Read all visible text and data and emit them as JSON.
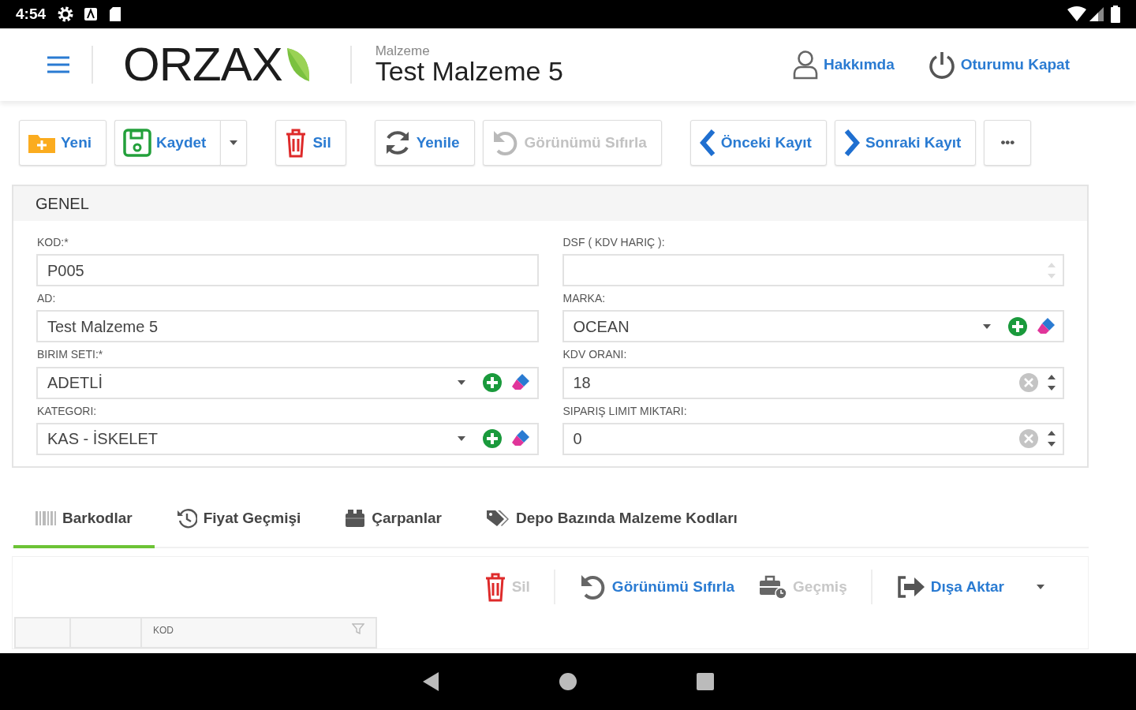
{
  "status_bar": {
    "time": "4:54"
  },
  "header": {
    "logo": "ORZAX",
    "page_kind": "Malzeme",
    "title": "Test Malzeme 5",
    "links": [
      {
        "label": "Hakkımda"
      },
      {
        "label": "Oturumu Kapat"
      }
    ]
  },
  "toolbar": {
    "groups": [
      [
        {
          "label": "Yeni",
          "kind": "button",
          "disabled": false
        },
        {
          "label": "Kaydet",
          "kind": "split",
          "disabled": false
        }
      ],
      [
        {
          "label": "Sil",
          "kind": "button",
          "disabled": false
        }
      ],
      [
        {
          "label": "Yenile",
          "kind": "button",
          "disabled": false
        },
        {
          "label": "Görünümü Sıfırla",
          "kind": "button",
          "disabled": true
        }
      ],
      [
        {
          "label": "Önceki Kayıt",
          "kind": "button",
          "disabled": false
        },
        {
          "label": "Sonraki Kayıt",
          "kind": "button",
          "disabled": false
        },
        {
          "label": "•••",
          "kind": "more",
          "disabled": false
        }
      ]
    ]
  },
  "panel": {
    "title": "GENEL",
    "columns": [
      [
        {
          "label": "KOD:*",
          "kind": "text",
          "value": "P005"
        },
        {
          "label": "AD:",
          "kind": "text",
          "value": "Test Malzeme 5"
        },
        {
          "label": "BIRIM SETI:*",
          "kind": "select",
          "value": "ADETLİ"
        },
        {
          "label": "KATEGORI:",
          "kind": "select",
          "value": "KAS - İSKELET"
        }
      ],
      [
        {
          "label": "DSF ( KDV HARIÇ ):",
          "kind": "number"
        },
        {
          "label": "MARKA:",
          "kind": "select",
          "value": "OCEAN"
        },
        {
          "label": "KDV ORANI:",
          "kind": "number",
          "value": "18"
        },
        {
          "label": "SIPARIŞ LIMIT MIKTARI:",
          "kind": "number",
          "value": "0"
        }
      ]
    ]
  },
  "tabs": [
    {
      "label": "Barkodlar",
      "selected": true
    },
    {
      "label": "Fiyat Geçmişi",
      "selected": false
    },
    {
      "label": "Çarpanlar",
      "selected": false
    },
    {
      "label": "Depo Bazında Malzeme Kodları",
      "selected": false
    }
  ],
  "grid_toolbar": {
    "groups": [
      [
        {
          "label": "Sil",
          "kind": "button",
          "disabled": true
        }
      ],
      [
        {
          "label": "Görünümü Sıfırla",
          "kind": "button",
          "disabled": false
        },
        {
          "label": "Geçmiş",
          "kind": "button",
          "disabled": true
        }
      ],
      [
        {
          "label": "Dışa Aktar",
          "kind": "dropdown",
          "disabled": false
        }
      ]
    ]
  },
  "table": {
    "columns": [
      {},
      {},
      {
        "label": "KOD"
      }
    ]
  }
}
